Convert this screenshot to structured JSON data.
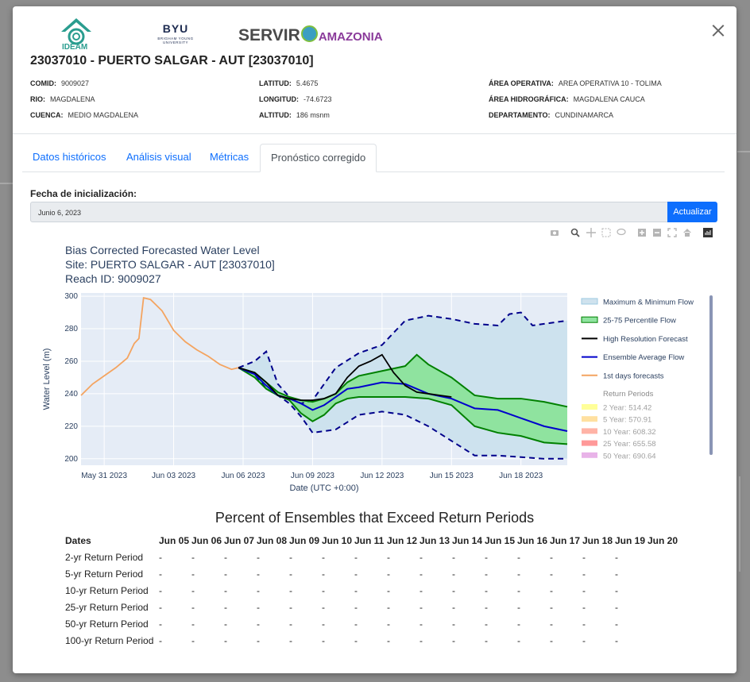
{
  "header": {
    "logos": [
      "IDEAM",
      "BYU",
      "BRIGHAM YOUNG UNIVERSITY",
      "SERVIR",
      "AMAZONIA"
    ],
    "station_title": "23037010 - PUERTO SALGAR - AUT [23037010]"
  },
  "meta": {
    "comid_label": "COMID:",
    "comid": "9009027",
    "rio_label": "RIO:",
    "rio": "MAGDALENA",
    "cuenca_label": "CUENCA:",
    "cuenca": "MEDIO MAGDALENA",
    "latitud_label": "LATITUD:",
    "latitud": "5.4675",
    "longitud_label": "LONGITUD:",
    "longitud": "-74.6723",
    "altitud_label": "ALTITUD:",
    "altitud": "186 msnm",
    "area_op_label": "ÁREA OPERATIVA:",
    "area_op": "AREA OPERATIVA 10 - TOLIMA",
    "area_hidro_label": "ÁREA HIDROGRÁFICA:",
    "area_hidro": "MAGDALENA CAUCA",
    "depto_label": "DEPARTAMENTO:",
    "depto": "CUNDINAMARCA"
  },
  "tabs": [
    "Datos históricos",
    "Análisis visual",
    "Métricas",
    "Pronóstico corregido"
  ],
  "form": {
    "date_label": "Fecha de inicialización:",
    "date_value": "Junio 6, 2023",
    "button": "Actualizar"
  },
  "modebar_icons": [
    "camera-icon",
    "zoom-icon",
    "pan-icon",
    "box-select-icon",
    "lasso-icon",
    "zoom-in-icon",
    "zoom-out-icon",
    "autoscale-icon",
    "reset-axes-icon",
    "plotly-logo-icon"
  ],
  "chart_data": {
    "type": "line",
    "title_lines": [
      "Bias Corrected Forecasted Water Level",
      "Site: PUERTO SALGAR - AUT [23037010]",
      "Reach ID: 9009027"
    ],
    "xlabel": "Date (UTC +0:00)",
    "ylabel": "Water Level (m)",
    "ylim": [
      196,
      302
    ],
    "xlim": [
      30.0,
      51.0
    ],
    "y_ticks": [
      200,
      220,
      240,
      260,
      280,
      300
    ],
    "x_ticks": [
      {
        "x": 31,
        "label": "May 31 2023"
      },
      {
        "x": 34,
        "label": "Jun 03 2023"
      },
      {
        "x": 37,
        "label": "Jun 06 2023"
      },
      {
        "x": 40,
        "label": "Jun 09 2023"
      },
      {
        "x": 43,
        "label": "Jun 12 2023"
      },
      {
        "x": 46,
        "label": "Jun 15 2023"
      },
      {
        "x": 49,
        "label": "Jun 18 2023"
      }
    ],
    "legend": [
      {
        "name": "Maximum & Minimum Flow",
        "color": "#cfe2ee",
        "kind": "area"
      },
      {
        "name": "25-75 Percentile Flow",
        "color": "#8fe39f",
        "kind": "area"
      },
      {
        "name": "High Resolution Forecast",
        "color": "#000000",
        "kind": "line"
      },
      {
        "name": "Ensemble Average Flow",
        "color": "#0000cc",
        "kind": "line"
      },
      {
        "name": "1st days forecasts",
        "color": "#f4a460",
        "kind": "line"
      }
    ],
    "return_periods_title": "Return Periods",
    "return_periods": [
      {
        "name": "2 Year: 514.42",
        "color": "#ffff99"
      },
      {
        "name": "5 Year: 570.91",
        "color": "#ffe0a0"
      },
      {
        "name": "10 Year: 608.32",
        "color": "#ffb3a6"
      },
      {
        "name": "25 Year: 655.58",
        "color": "#ff9999"
      },
      {
        "name": "50 Year: 690.64",
        "color": "#e8b3e8"
      }
    ],
    "series": [
      {
        "name": "1st days forecasts",
        "x": [
          30.0,
          30.5,
          31.0,
          31.5,
          32.0,
          32.3,
          32.5,
          32.7,
          33.0,
          33.5,
          34.0,
          34.5,
          35.0,
          35.5,
          36.0,
          36.5,
          36.8
        ],
        "y": [
          239,
          246,
          251,
          256,
          262,
          271,
          274,
          299,
          298,
          291,
          279,
          272,
          267,
          263,
          258,
          255,
          256
        ]
      },
      {
        "name": "Maximum Flow",
        "x": [
          36.8,
          37.5,
          38.0,
          38.5,
          39.0,
          39.5,
          40.0,
          41.0,
          42.0,
          43.0,
          44.0,
          45.0,
          46.0,
          47.0,
          48.0,
          48.5,
          49.0,
          49.5,
          50.0,
          51.0
        ],
        "y": [
          256,
          260,
          266,
          246,
          238,
          234,
          236,
          256,
          265,
          270,
          285,
          288,
          286,
          283,
          282,
          289,
          290,
          282,
          283,
          285
        ]
      },
      {
        "name": "Minimum Flow",
        "x": [
          36.8,
          37.5,
          38.0,
          38.5,
          39.0,
          39.5,
          40.0,
          41.0,
          42.0,
          43.0,
          44.0,
          45.0,
          46.0,
          47.0,
          48.0,
          49.0,
          50.0,
          51.0
        ],
        "y": [
          256,
          252,
          243,
          239,
          234,
          226,
          216,
          218,
          227,
          229,
          227,
          220,
          211,
          202,
          202,
          201,
          200,
          200
        ]
      },
      {
        "name": "75 Percentile",
        "x": [
          36.8,
          37.5,
          38.0,
          38.5,
          39.0,
          39.5,
          40.0,
          40.5,
          41.0,
          41.5,
          42.0,
          43.0,
          44.0,
          44.5,
          45.0,
          46.0,
          47.0,
          48.0,
          49.0,
          50.0,
          51.0
        ],
        "y": [
          256,
          253,
          247,
          241,
          238,
          236,
          235,
          237,
          240,
          247,
          251,
          254,
          257,
          264,
          258,
          250,
          239,
          237,
          237,
          235,
          232
        ]
      },
      {
        "name": "25 Percentile",
        "x": [
          36.8,
          37.5,
          38.0,
          38.5,
          39.0,
          39.5,
          40.0,
          40.5,
          41.0,
          41.5,
          42.0,
          43.0,
          44.0,
          45.0,
          46.0,
          47.0,
          48.0,
          49.0,
          50.0,
          51.0
        ],
        "y": [
          256,
          250,
          243,
          239,
          236,
          228,
          223,
          227,
          234,
          237,
          238,
          238,
          238,
          237,
          233,
          220,
          216,
          214,
          210,
          209
        ]
      },
      {
        "name": "High Resolution Forecast",
        "x": [
          36.8,
          37.5,
          38.0,
          38.5,
          39.0,
          39.5,
          40.0,
          40.5,
          41.0,
          41.5,
          42.0,
          42.5,
          43.0,
          43.5,
          44.0,
          44.5,
          45.0,
          45.5,
          46.0
        ],
        "y": [
          256,
          253,
          247,
          239,
          237,
          236,
          236,
          237,
          240,
          250,
          257,
          260,
          264,
          253,
          245,
          241,
          240,
          239,
          238
        ]
      },
      {
        "name": "Ensemble Average Flow",
        "x": [
          36.8,
          37.5,
          38.0,
          38.5,
          39.0,
          39.5,
          40.0,
          40.5,
          41.0,
          41.5,
          42.0,
          43.0,
          44.0,
          45.0,
          46.0,
          47.0,
          48.0,
          49.0,
          50.0,
          51.0
        ],
        "y": [
          256,
          252,
          245,
          239,
          237,
          234,
          230,
          233,
          238,
          243,
          244,
          247,
          246,
          240,
          237,
          231,
          230,
          225,
          220,
          217
        ]
      }
    ]
  },
  "return_table": {
    "title": "Percent of Ensembles that Exceed Return Periods",
    "columns": [
      "Dates",
      "Jun 05",
      "Jun 06",
      "Jun 07",
      "Jun 08",
      "Jun 09",
      "Jun 10",
      "Jun 11",
      "Jun 12",
      "Jun 13",
      "Jun 14",
      "Jun 15",
      "Jun 16",
      "Jun 17",
      "Jun 18",
      "Jun 19",
      "Jun 20"
    ],
    "rows": [
      {
        "label": "2-yr Return Period",
        "values": [
          "-",
          "-",
          "-",
          "-",
          "-",
          "-",
          "-",
          "-",
          "-",
          "-",
          "-",
          "-",
          "-",
          "-",
          "-"
        ]
      },
      {
        "label": "5-yr Return Period",
        "values": [
          "-",
          "-",
          "-",
          "-",
          "-",
          "-",
          "-",
          "-",
          "-",
          "-",
          "-",
          "-",
          "-",
          "-",
          "-"
        ]
      },
      {
        "label": "10-yr Return Period",
        "values": [
          "-",
          "-",
          "-",
          "-",
          "-",
          "-",
          "-",
          "-",
          "-",
          "-",
          "-",
          "-",
          "-",
          "-",
          "-"
        ]
      },
      {
        "label": "25-yr Return Period",
        "values": [
          "-",
          "-",
          "-",
          "-",
          "-",
          "-",
          "-",
          "-",
          "-",
          "-",
          "-",
          "-",
          "-",
          "-",
          "-"
        ]
      },
      {
        "label": "50-yr Return Period",
        "values": [
          "-",
          "-",
          "-",
          "-",
          "-",
          "-",
          "-",
          "-",
          "-",
          "-",
          "-",
          "-",
          "-",
          "-",
          "-"
        ]
      },
      {
        "label": "100-yr Return Period",
        "values": [
          "-",
          "-",
          "-",
          "-",
          "-",
          "-",
          "-",
          "-",
          "-",
          "-",
          "-",
          "-",
          "-",
          "-",
          "-"
        ]
      }
    ]
  }
}
